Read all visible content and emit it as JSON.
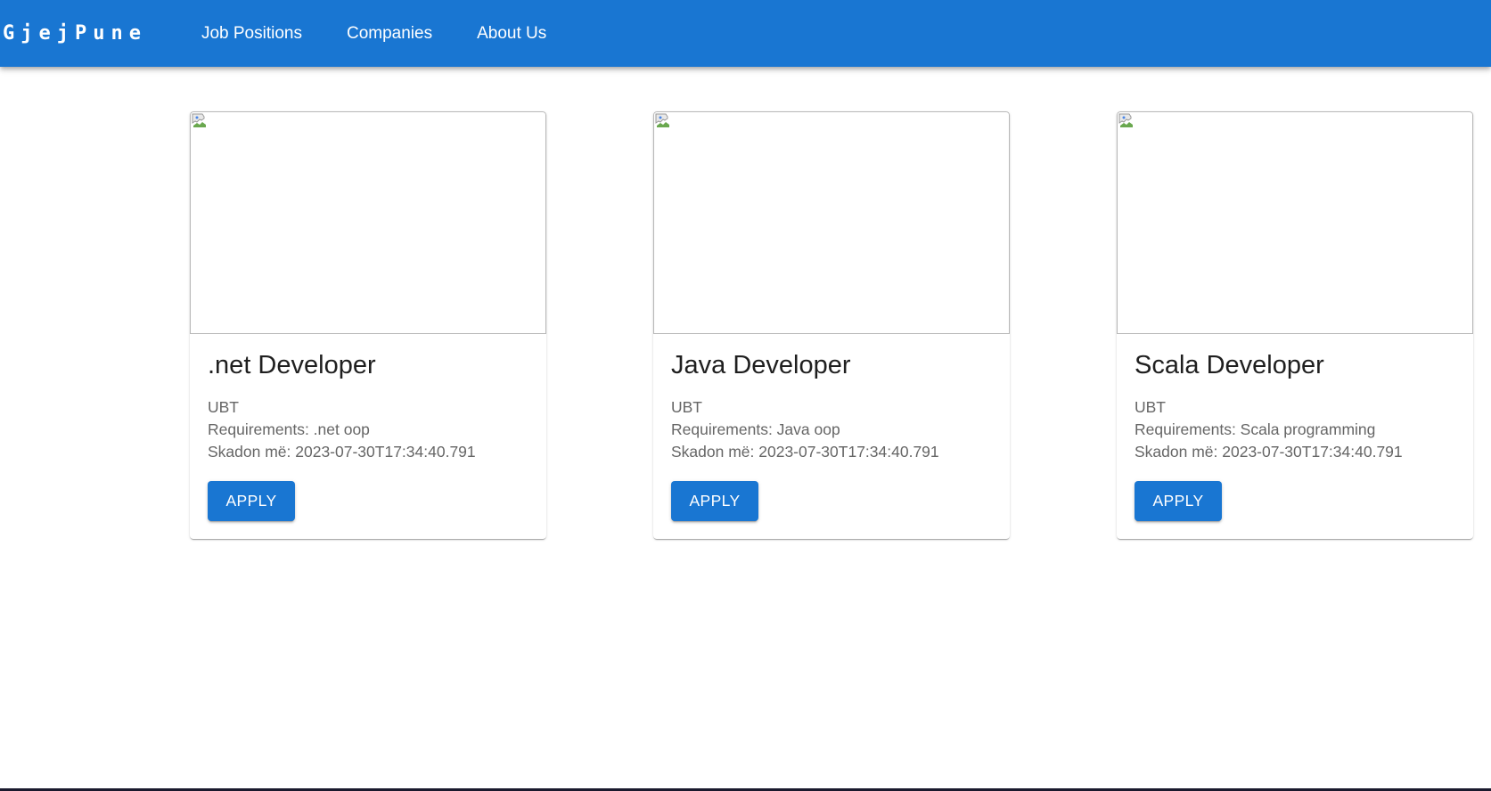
{
  "app": {
    "logo": "GjejPune",
    "nav": [
      {
        "label": "Job Positions"
      },
      {
        "label": "Companies"
      },
      {
        "label": "About Us"
      }
    ]
  },
  "jobs": [
    {
      "title": ".net Developer",
      "company": "UBT",
      "requirements": "Requirements: .net oop",
      "expires": "Skadon më: 2023-07-30T17:34:40.791",
      "apply_label": "APPLY"
    },
    {
      "title": "Java Developer",
      "company": "UBT",
      "requirements": "Requirements: Java oop",
      "expires": "Skadon më: 2023-07-30T17:34:40.791",
      "apply_label": "APPLY"
    },
    {
      "title": "Scala Developer",
      "company": "UBT",
      "requirements": "Requirements: Scala programming",
      "expires": "Skadon më: 2023-07-30T17:34:40.791",
      "apply_label": "APPLY"
    }
  ],
  "colors": {
    "primary": "#1976d2",
    "text_primary": "#1f1f1f",
    "text_secondary": "#666666"
  },
  "icons": {
    "card_image": "broken-image-icon"
  }
}
